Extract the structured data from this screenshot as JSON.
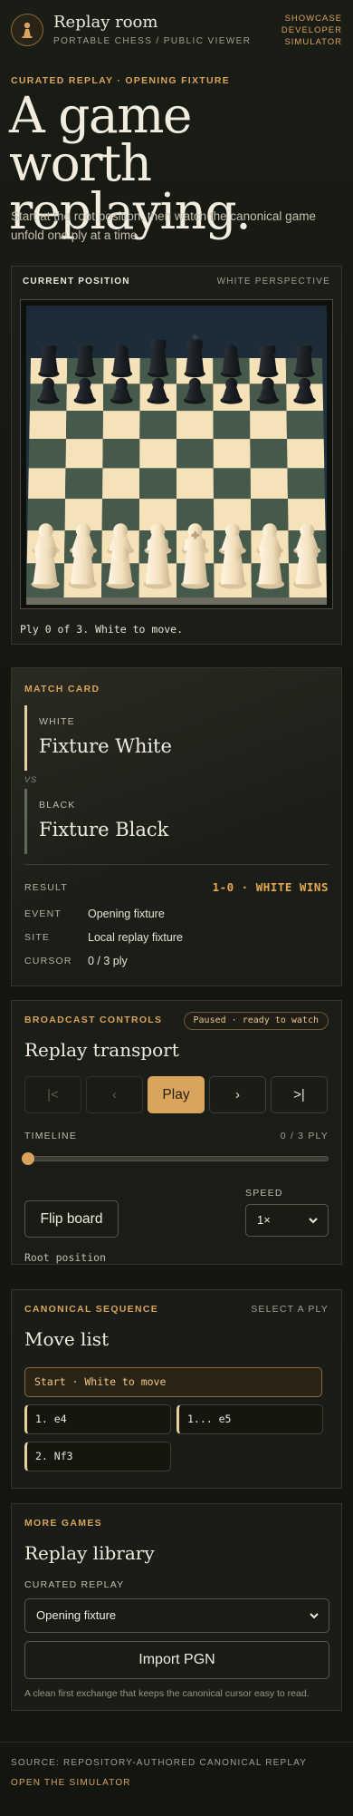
{
  "header": {
    "title": "Replay room",
    "subtitle": "PORTABLE CHESS / PUBLIC VIEWER",
    "nav": [
      "SHOWCASE",
      "DEVELOPER",
      "SIMULATOR"
    ]
  },
  "hero": {
    "eyebrow": "CURATED REPLAY · OPENING FIXTURE",
    "title": "A game worth replaying.",
    "subtitle": "Start at the root position, then watch the canonical game unfold one ply at a time."
  },
  "board": {
    "label": "CURRENT POSITION",
    "perspective": "WHITE PERSPECTIVE",
    "status": "Ply 0 of 3. White to move."
  },
  "match": {
    "label": "MATCH CARD",
    "white_role": "WHITE",
    "white_name": "Fixture White",
    "vs": "VS",
    "black_role": "BLACK",
    "black_name": "Fixture Black",
    "result_label": "RESULT",
    "result_value": "1-0 · WHITE WINS",
    "event_label": "EVENT",
    "event_value": "Opening fixture",
    "site_label": "SITE",
    "site_value": "Local replay fixture",
    "cursor_label": "CURSOR",
    "cursor_value": "0 / 3 ply"
  },
  "broadcast": {
    "label": "BROADCAST CONTROLS",
    "status_pill": "Paused · ready to watch",
    "title": "Replay transport",
    "first_label": "|<",
    "prev_label": "‹",
    "play_label": "Play",
    "next_label": "›",
    "last_label": ">|",
    "timeline_label": "TIMELINE",
    "timeline_value": "0 / 3 PLY",
    "timeline_progress": 0,
    "flip_label": "Flip board",
    "speed_label": "SPEED",
    "speed_value": "1×",
    "position_note": "Root position"
  },
  "moves": {
    "label": "CANONICAL SEQUENCE",
    "hint": "SELECT A PLY",
    "title": "Move list",
    "start": "Start · White to move",
    "items": [
      "1. e4",
      "1... e5",
      "2. Nf3"
    ]
  },
  "library": {
    "label": "MORE GAMES",
    "title": "Replay library",
    "select_label": "CURATED REPLAY",
    "select_value": "Opening fixture",
    "import_label": "Import PGN",
    "note": "A clean first exchange that keeps the canonical cursor easy to read."
  },
  "footer": {
    "source": "SOURCE: REPOSITORY-AUTHORED CANONICAL REPLAY",
    "link": "OPEN THE SIMULATOR"
  },
  "colors": {
    "accent": "#d9a45c",
    "board_light": "#f6e2b8",
    "board_dark": "#465a4c",
    "background": "#14160f"
  }
}
